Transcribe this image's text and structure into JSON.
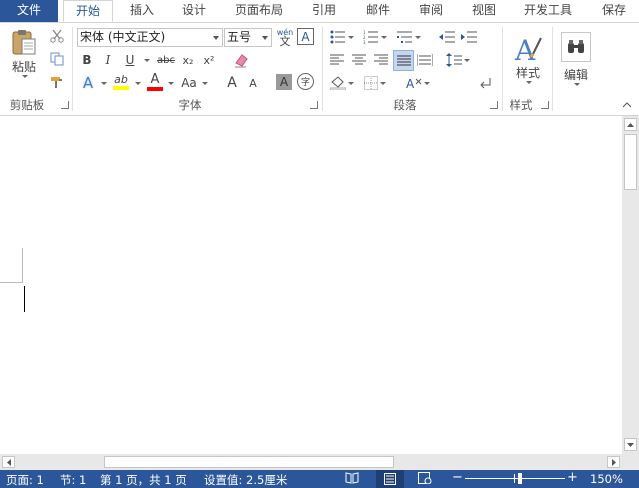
{
  "tabs": [
    "文件",
    "开始",
    "插入",
    "设计",
    "页面布局",
    "引用",
    "邮件",
    "审阅",
    "视图",
    "开发工具",
    "保存"
  ],
  "clipboard": {
    "paste_label": "粘贴",
    "group_label": "剪贴板"
  },
  "font": {
    "font_name": "宋体 (中文正文)",
    "font_size": "五号",
    "phonetic_glyph": "wén",
    "phonetic_base": "文",
    "border_glyph": "A",
    "bold": "B",
    "italic": "I",
    "underline": "U",
    "strike": "abc",
    "subscript": "x₂",
    "superscript": "x²",
    "effects": "A",
    "highlight": "ab",
    "font_color": "A",
    "case": "Aa",
    "grow": "A",
    "shrink": "A",
    "shading": "A",
    "enclose": "字",
    "group_label": "字体"
  },
  "paragraph": {
    "group_label": "段落"
  },
  "styles": {
    "button_label": "样式",
    "group_label": "样式"
  },
  "editing": {
    "button_label": "编辑"
  },
  "status": {
    "page": "页面: 1",
    "section": "节: 1",
    "page_count": "第 1 页，共 1 页",
    "setting": "设置值: 2.5厘米",
    "zoom": "150%"
  },
  "colors": {
    "brand": "#2b579a",
    "highlight": "#ffff00",
    "font_color": "#ff0000"
  }
}
